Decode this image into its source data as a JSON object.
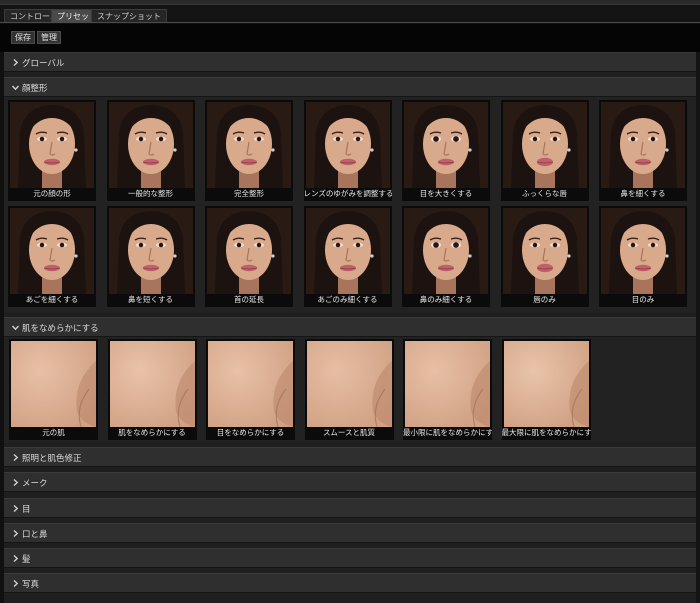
{
  "tabs": [
    {
      "label": "コントロール",
      "active": false
    },
    {
      "label": "プリセット",
      "active": true
    },
    {
      "label": "スナップショット",
      "active": false
    }
  ],
  "toolbar": {
    "save_label": "保存",
    "manage_label": "管理"
  },
  "sections": {
    "global": {
      "label": "グローバル",
      "expanded": false
    },
    "face_shape": {
      "label": "顔整形",
      "expanded": true,
      "presets": [
        "元の顔の形",
        "一般的な整形",
        "完全整形",
        "レンズのゆがみを調整する",
        "目を大きくする",
        "ふっくらな唇",
        "鼻を細くする",
        "あごを細くする",
        "鼻を短くする",
        "首の延長",
        "あごのみ細くする",
        "鼻のみ細くする",
        "唇のみ",
        "目のみ"
      ]
    },
    "skin_smooth": {
      "label": "肌をなめらかにする",
      "expanded": true,
      "presets": [
        "元の肌",
        "肌をなめらかにする",
        "目をなめらかにする",
        "スムースと肌質",
        "最小限に肌をなめらかにする",
        "最大限に肌をなめらかにする"
      ]
    },
    "lighting": {
      "label": "照明と肌色修正",
      "expanded": false
    },
    "makeup": {
      "label": "メーク",
      "expanded": false
    },
    "eyes": {
      "label": "目",
      "expanded": false
    },
    "mouth_nose": {
      "label": "口と鼻",
      "expanded": false
    },
    "hair": {
      "label": "髪",
      "expanded": false
    },
    "photo": {
      "label": "写真",
      "expanded": false
    }
  },
  "colors": {
    "skin": "#d9a98c",
    "skin_shadow": "#a8755c",
    "hair": "#1c1210",
    "lips": "#c0606a",
    "skin_patch": "#e3bba0"
  },
  "icons": {
    "collapsed": "chevron-right-icon",
    "expanded": "chevron-down-icon"
  }
}
